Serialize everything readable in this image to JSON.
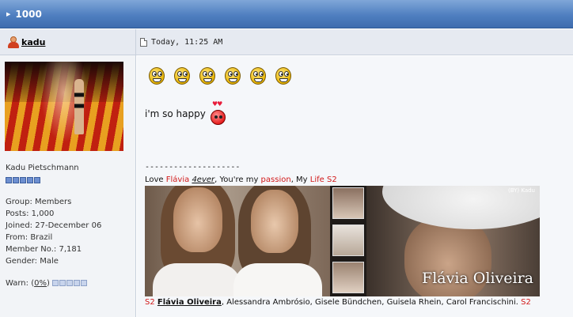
{
  "topic": {
    "title": "1000"
  },
  "poster": {
    "username": "kadu",
    "real_name": "Kadu Pietschmann",
    "rank_pips_filled": 5,
    "group": "Group: Members",
    "posts": "Posts: 1,000",
    "joined": "Joined: 27-December 06",
    "from": "From: Brazil",
    "member_no": "Member No.: 7,181",
    "gender": "Gender: Male",
    "warn_label": "Warn: (",
    "warn_value": "0%",
    "warn_close": ")",
    "warn_level": 0
  },
  "post": {
    "timestamp": "Today, 11:25 AM",
    "smiley_count": 6,
    "message": "i'm so happy",
    "signature": {
      "dashes": "--------------------",
      "love_prefix": "Love ",
      "love_name": "Flávia",
      "love_space": " ",
      "love_forever": "4ever",
      "love_mid": ", You're my ",
      "love_passion": "passion",
      "love_comma": ", My ",
      "love_life": "Life",
      "love_s2": " S2",
      "banner_credit": "(BY) Kadu",
      "banner_name": "Flávia Oliveira",
      "names_s2_start": "S2",
      "names_first": "Flávia Oliveira",
      "names_rest": ", Alessandra Ambrósio, Gisele Bündchen, Guisela Rhein, Carol Francischini.",
      "names_s2_end": "S2"
    }
  },
  "colors": {
    "title_bar": "#4f7fc0",
    "panel_bg": "#e6eaf1",
    "accent_red": "#d21a1a",
    "pip_blue": "#6d8fd0"
  }
}
